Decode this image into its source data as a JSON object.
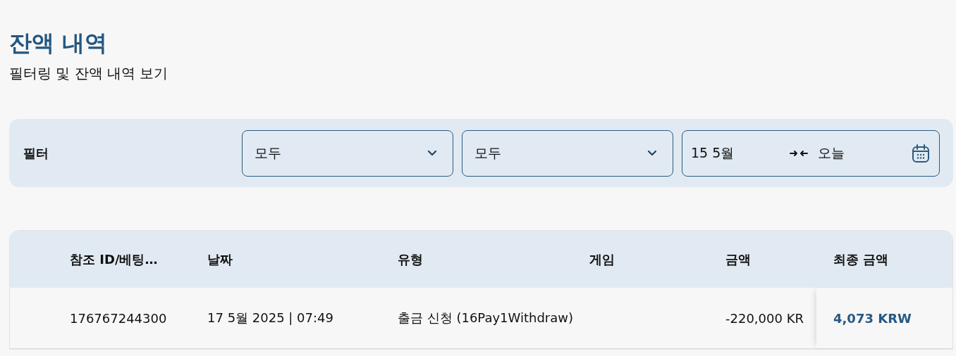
{
  "page": {
    "title": "잔액 내역",
    "subtitle": "필터링 및 잔액 내역 보기"
  },
  "filter": {
    "label": "필터",
    "selects": [
      {
        "value": "모두"
      },
      {
        "value": "모두"
      }
    ],
    "date_range": {
      "from": "15 5월",
      "to": "오늘"
    }
  },
  "table": {
    "columns": [
      {
        "label": "참조 ID/베팅…"
      },
      {
        "label": "날짜"
      },
      {
        "label": "유형"
      },
      {
        "label": "게임"
      },
      {
        "label": "금액"
      },
      {
        "label": "최종 금액"
      }
    ],
    "rows": [
      {
        "cells": [
          "176767244300",
          "17 5월 2025 | 07:49",
          "출금 신청 (16Pay1Withdraw)",
          "",
          "-220,000 KR",
          "4,073 KRW"
        ]
      }
    ]
  }
}
